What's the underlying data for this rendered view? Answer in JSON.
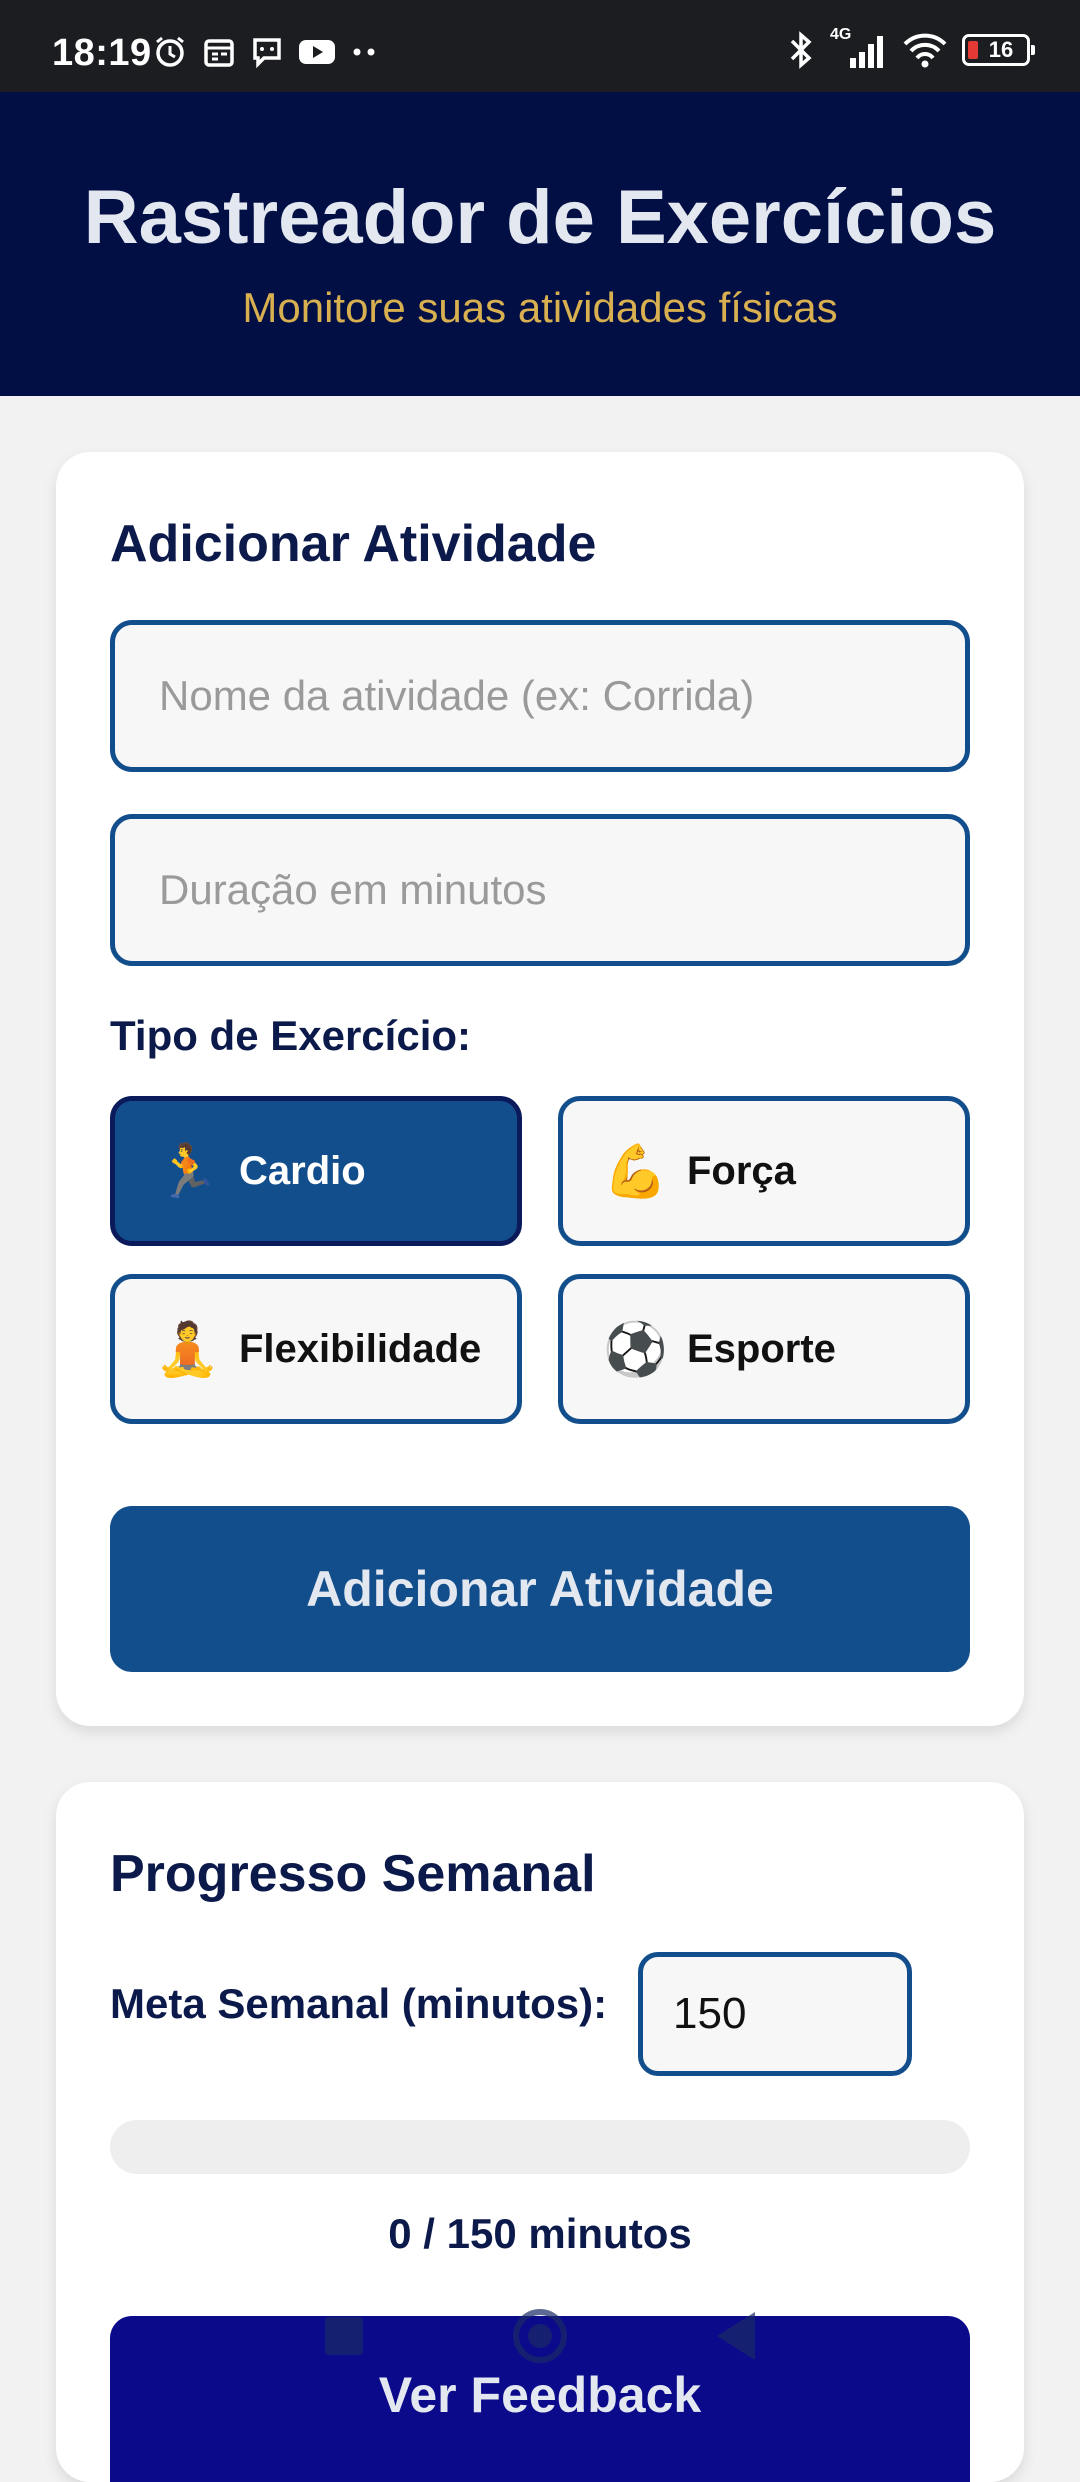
{
  "status_bar": {
    "time": "18:19",
    "network": "4G",
    "battery": "16"
  },
  "header": {
    "title": "Rastreador de Exercícios",
    "subtitle": "Monitore suas atividades físicas"
  },
  "add_activity": {
    "title": "Adicionar Atividade",
    "name_field": {
      "placeholder": "Nome da atividade (ex: Corrida)",
      "value": ""
    },
    "duration_field": {
      "placeholder": "Duração em minutos",
      "value": ""
    },
    "type_label": "Tipo de Exercício:",
    "types": [
      {
        "emoji": "🏃",
        "icon": "running-icon",
        "label": "Cardio",
        "selected": true
      },
      {
        "emoji": "💪",
        "icon": "muscle-icon",
        "label": "Força",
        "selected": false
      },
      {
        "emoji": "🧘",
        "icon": "yoga-icon",
        "label": "Flexibilidade",
        "selected": false
      },
      {
        "emoji": "⚽",
        "icon": "soccer-ball-icon",
        "label": "Esporte",
        "selected": false
      }
    ],
    "submit_label": "Adicionar Atividade"
  },
  "weekly_progress": {
    "title": "Progresso Semanal",
    "goal_label": "Meta Semanal (minutos):",
    "goal_value": "150",
    "progress_fraction": 0,
    "progress_text": "0 / 150 minutos",
    "feedback_label": "Ver Feedback"
  },
  "colors": {
    "header_bg": "#020f45",
    "accent": "#134e8c",
    "subtitle": "#d9b050",
    "feedback_btn": "#0b0a8a"
  }
}
